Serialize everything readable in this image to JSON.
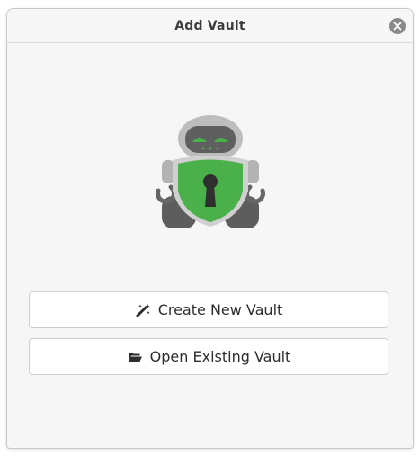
{
  "window": {
    "title": "Add Vault"
  },
  "actions": {
    "create_label": "Create New Vault",
    "create_icon": "magic-wand-icon",
    "open_label": "Open Existing Vault",
    "open_icon": "folder-open-icon"
  },
  "colors": {
    "accent_green": "#49b04a",
    "robot_gray": "#9b9b9b",
    "robot_dark": "#5a5a5a"
  }
}
